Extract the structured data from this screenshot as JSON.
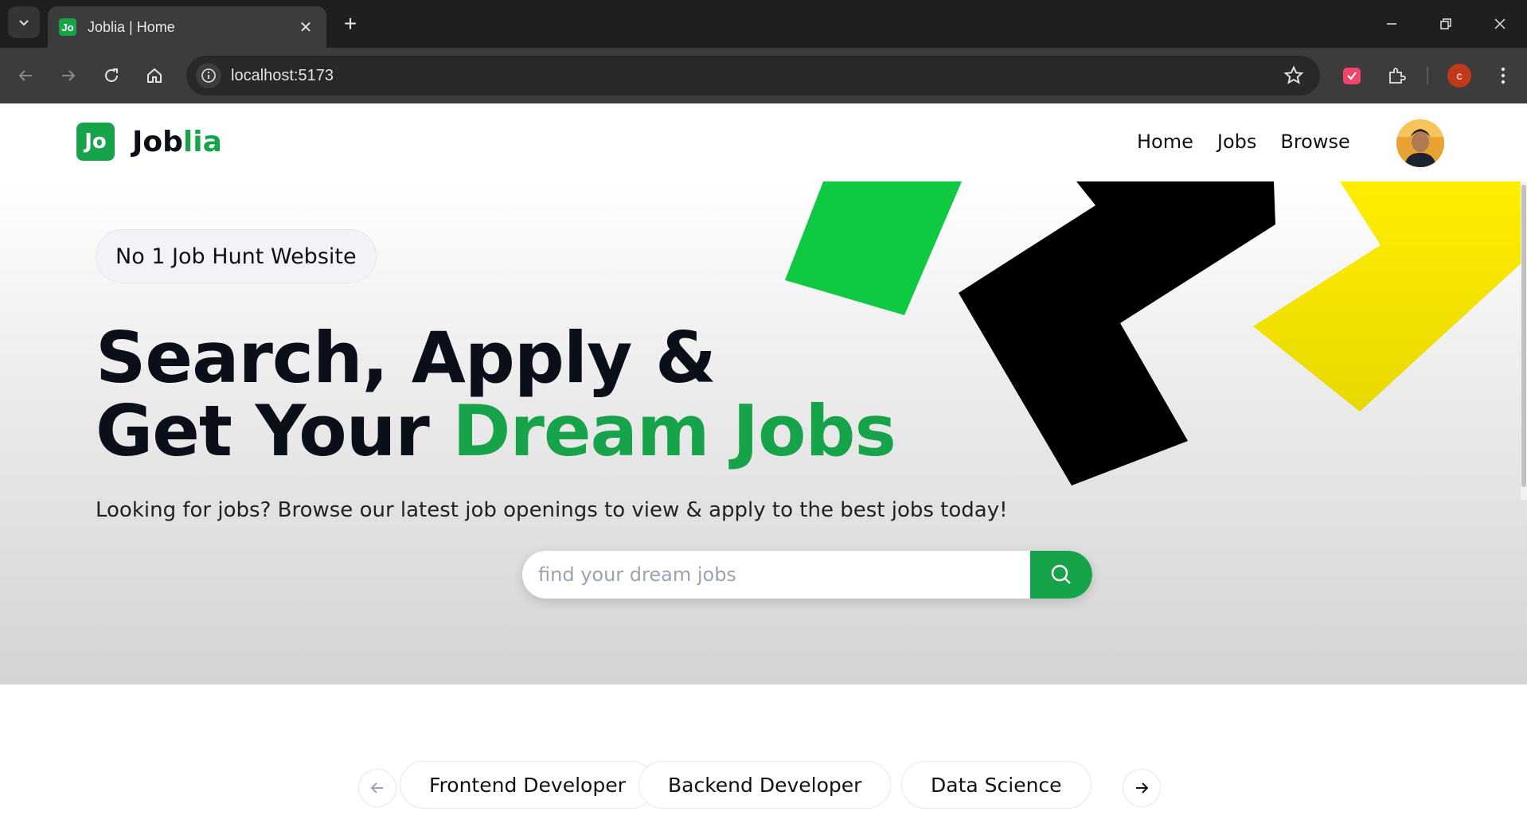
{
  "browser": {
    "tab_title": "Joblia | Home",
    "favicon_text": "Jo",
    "url": "localhost:5173",
    "profile_initial": "c"
  },
  "site": {
    "logo_mark": "Jo",
    "brand_prefix": "Job",
    "brand_suffix": "lia",
    "nav": [
      "Home",
      "Jobs",
      "Browse"
    ]
  },
  "hero": {
    "badge": "No 1 Job Hunt Website",
    "headline_line1": "Search, Apply &",
    "headline_line2_prefix": "Get Your ",
    "headline_line2_accent": "Dream Jobs",
    "subtitle": "Looking for jobs? Browse our latest job openings to view & apply to the best jobs today!",
    "search_placeholder": "find your dream jobs"
  },
  "categories": [
    "Frontend Developer",
    "Backend Developer",
    "Data Science"
  ],
  "colors": {
    "brand_green": "#16a34a",
    "shape_green": "#10c943",
    "shape_black": "#000000",
    "shape_yellow": "#f5e800"
  }
}
